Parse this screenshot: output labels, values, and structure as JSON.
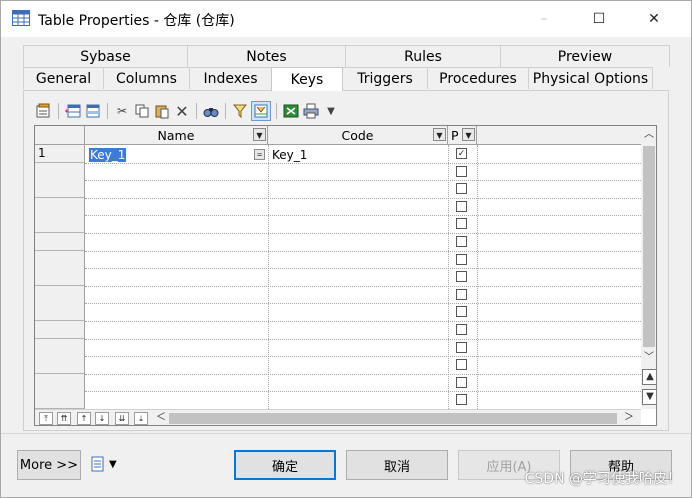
{
  "window": {
    "title": "Table Properties - 仓库 (仓库)",
    "controls": {
      "minimize": "–",
      "maximize": "☐",
      "close": "✕"
    }
  },
  "tabs": {
    "row1": [
      "Sybase",
      "Notes",
      "Rules",
      "Preview"
    ],
    "row2": [
      "General",
      "Columns",
      "Indexes",
      "Keys",
      "Triggers",
      "Procedures",
      "Physical Options"
    ],
    "active": "Keys"
  },
  "toolbar": {
    "icons": [
      "properties-icon",
      "add-row-icon",
      "insert-row-icon",
      "cut-icon",
      "copy-icon",
      "paste-icon",
      "delete-icon",
      "find-icon",
      "filter-icon",
      "customize-columns-icon",
      "excel-export-icon",
      "print-icon",
      "dropdown-arrow-icon"
    ]
  },
  "grid": {
    "columns": [
      "Name",
      "Code",
      "P"
    ],
    "rows": [
      {
        "num": "1",
        "name": "Key_1",
        "code": "Key_1",
        "primary": true
      }
    ],
    "checkbox_count": 15,
    "nav_buttons": [
      "⤒",
      "⇈",
      "↑",
      "↓",
      "⇊",
      "⤓"
    ]
  },
  "footer": {
    "more": "More >>",
    "ok": "确定",
    "cancel": "取消",
    "apply": "应用(A)",
    "help": "帮助"
  },
  "watermark": "CSDN @学习使我哈皮！",
  "colors": {
    "selection": "#3d7bd6",
    "default_button_border": "#0078d7"
  }
}
